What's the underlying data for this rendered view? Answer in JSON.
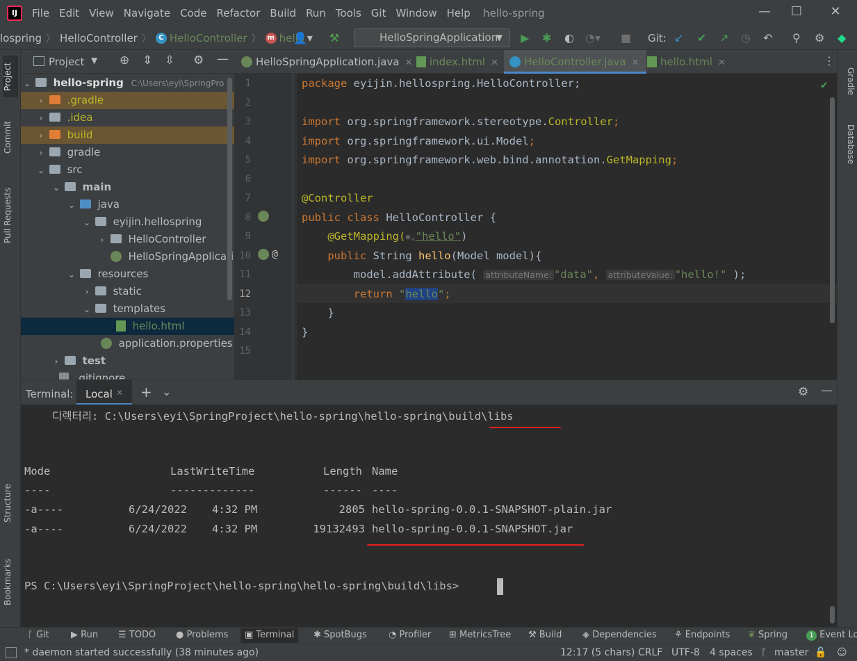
{
  "menubar": {
    "logo": "IJ",
    "items": [
      "File",
      "Edit",
      "View",
      "Navigate",
      "Code",
      "Refactor",
      "Build",
      "Run",
      "Tools",
      "Git",
      "Window",
      "Help"
    ],
    "title": "hello-spring",
    "minimize": "—",
    "maximize": "☐",
    "close": "✕"
  },
  "navbar": {
    "crumb1": "lospring",
    "crumb2": "HelloController",
    "crumb3": "HelloController",
    "crumb4": "hello",
    "run_config": "HelloSpringApplication",
    "git_label": "Git:"
  },
  "leftstripe": {
    "project": "Project",
    "commit": "Commit",
    "pull_requests": "Pull Requests",
    "structure": "Structure",
    "bookmarks": "Bookmarks"
  },
  "rightstripe": {
    "gradle": "Gradle",
    "database": "Database"
  },
  "project": {
    "title": "Project",
    "root": "hello-spring",
    "root_path": "C:\\Users\\eyi\\SpringPro",
    "items": [
      {
        "label": ".gradle"
      },
      {
        "label": ".idea"
      },
      {
        "label": "build"
      },
      {
        "label": "gradle"
      },
      {
        "label": "src"
      },
      {
        "label": "main"
      },
      {
        "label": "java"
      },
      {
        "label": "eyijin.hellospring"
      },
      {
        "label": "HelloController"
      },
      {
        "label": "HelloSpringApplicatio"
      },
      {
        "label": "resources"
      },
      {
        "label": "static"
      },
      {
        "label": "templates"
      },
      {
        "label": "hello.html"
      },
      {
        "label": "application.properties"
      },
      {
        "label": "test"
      },
      {
        "label": ".gitignore"
      }
    ]
  },
  "editor": {
    "tabs": [
      {
        "label": "HelloSpringApplication.java"
      },
      {
        "label": "index.html"
      },
      {
        "label": "HelloController.java"
      },
      {
        "label": "hello.html"
      }
    ],
    "line_numbers": [
      "1",
      "2",
      "3",
      "4",
      "5",
      "6",
      "7",
      "8",
      "9",
      "10",
      "11",
      "12",
      "13",
      "14",
      "15"
    ],
    "code": {
      "l1_kw": "package",
      "l1_rest": " eyijin.hellospring.HelloController;",
      "l3_kw": "import",
      "l3_rest": " org.springframework.stereotype.",
      "l3_cls": "Controller",
      "l3_end": ";",
      "l4_kw": "import",
      "l4_rest": " org.springframework.ui.Model",
      "l4_end": ";",
      "l5_kw": "import",
      "l5_rest": " org.springframework.web.bind.annotation.",
      "l5_cls": "GetMapping",
      "l5_end": ";",
      "l7_ann": "@Controller",
      "l8_kw": "public class",
      "l8_rest": " HelloController {",
      "l9_ann": "@GetMapping(",
      "l9_str": "\"hello\"",
      "l9_end": ")",
      "l10_kw": "public",
      "l10_rest": " String ",
      "l10_fn": "hello",
      "l10_end": "(Model model){",
      "l11_a": "model.addAttribute(",
      "l11_hint1": "attributeName:",
      "l11_s1": "\"data\"",
      "l11_comma": ",",
      "l11_hint2": "attributeValue:",
      "l11_s2": "\"hello!\"",
      "l11_end": " );",
      "l12_kw": "return",
      "l12_q1": "\"",
      "l12_sel": "hello",
      "l12_q2": "\"",
      "l12_end": ";",
      "l13": "}",
      "l14": "}"
    }
  },
  "terminal": {
    "label": "Terminal:",
    "tab": "Local",
    "directory_prefix": "디렉터리: C:\\Users\\eyi\\SpringProject\\hello-spring\\hello-spring\\",
    "directory_hl": "build\\libs",
    "col_mode": "Mode",
    "col_lwt": "LastWriteTime",
    "col_length": "Length",
    "col_name": "Name",
    "dash_mode": "----",
    "dash_lwt": "-------------",
    "dash_length": "------",
    "dash_name": "----",
    "rows": [
      {
        "mode": "-a----",
        "date": "6/24/2022",
        "time": "4:32 PM",
        "length": "2805",
        "name": "hello-spring-0.0.1-SNAPSHOT-plain.jar"
      },
      {
        "mode": "-a----",
        "date": "6/24/2022",
        "time": "4:32 PM",
        "length": "19132493",
        "name": "hello-spring-0.0.1-SNAPSHOT.jar"
      }
    ],
    "prompt": "PS C:\\Users\\eyi\\SpringProject\\hello-spring\\hello-spring\\build\\libs>"
  },
  "bottom_tools": [
    "Git",
    "Run",
    "TODO",
    "Problems",
    "Terminal",
    "SpotBugs",
    "Profiler",
    "MetricsTree",
    "Build",
    "Dependencies",
    "Endpoints",
    "Spring",
    "Event Lo"
  ],
  "event_count": "1",
  "status": {
    "message": "* daemon started successfully (38 minutes ago)",
    "position": "12:17 (5 chars)",
    "line_sep": "CRLF",
    "encoding": "UTF-8",
    "indent": "4 spaces",
    "branch": "master"
  },
  "colors": {
    "bg": "#2b2b2b",
    "panel": "#3c3f41",
    "keyword": "#cc7832",
    "annotation": "#bbb529",
    "string": "#6a8759",
    "highlight_red": "#e41e1e"
  }
}
